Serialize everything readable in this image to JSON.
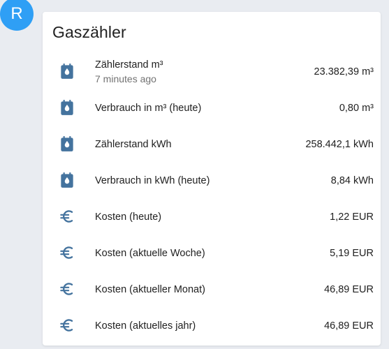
{
  "avatar": {
    "letter": "R"
  },
  "card": {
    "title": "Gaszähler",
    "rows": [
      {
        "icon": "meter-icon",
        "label": "Zählerstand m³",
        "secondary": "7 minutes ago",
        "value": "23.382,39 m³"
      },
      {
        "icon": "meter-icon",
        "label": "Verbrauch in m³ (heute)",
        "value": "0,80 m³"
      },
      {
        "icon": "meter-icon",
        "label": "Zählerstand kWh",
        "value": "258.442,1 kWh"
      },
      {
        "icon": "meter-icon",
        "label": "Verbrauch in kWh (heute)",
        "value": "8,84 kWh"
      },
      {
        "icon": "euro-icon",
        "label": "Kosten (heute)",
        "value": "1,22 EUR"
      },
      {
        "icon": "euro-icon",
        "label": "Kosten (aktuelle Woche)",
        "value": "5,19 EUR"
      },
      {
        "icon": "euro-icon",
        "label": "Kosten (aktueller Monat)",
        "value": "46,89 EUR"
      },
      {
        "icon": "euro-icon",
        "label": "Kosten (aktuelles jahr)",
        "value": "46,89 EUR"
      }
    ]
  },
  "colors": {
    "icon": "#44739e",
    "avatar": "#2f9ff5",
    "background": "#e9ecf1"
  }
}
